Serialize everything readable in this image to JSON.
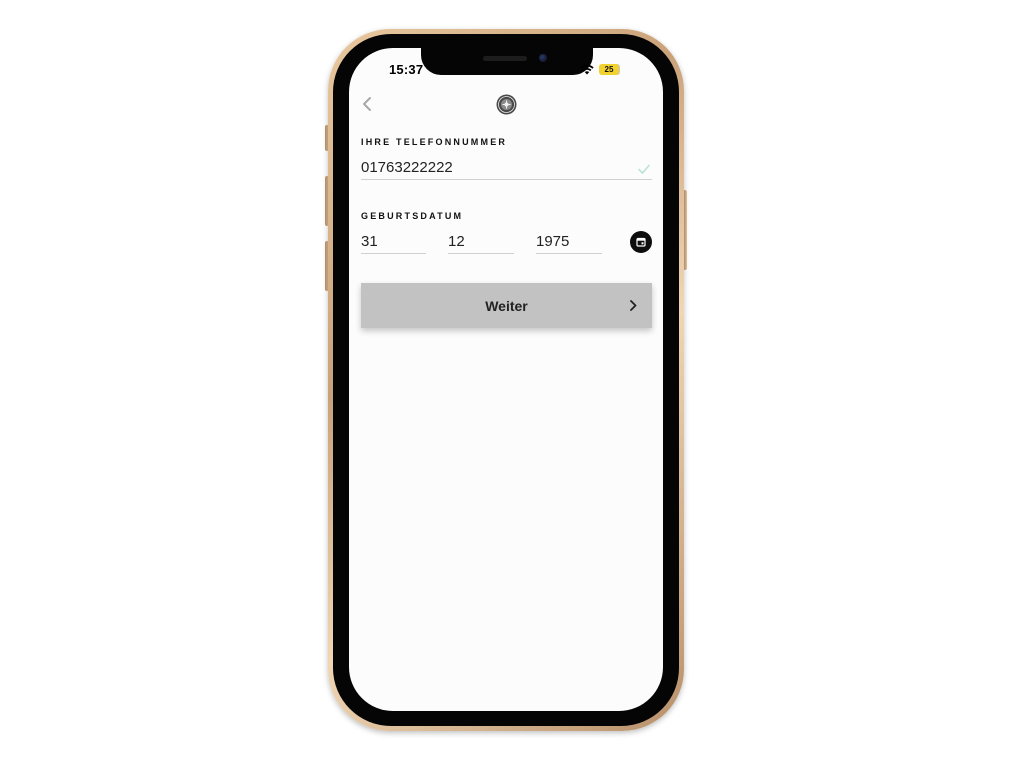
{
  "status_bar": {
    "time": "15:37",
    "battery": "25"
  },
  "header": {
    "back_icon": "chevron-left-icon",
    "logo_icon": "seal-logo-icon"
  },
  "phone_section": {
    "label": "IHRE TELEFONNUMMER",
    "value": "01763222222",
    "valid_icon": "check-icon"
  },
  "birthdate_section": {
    "label": "GEBURTSDATUM",
    "day": "31",
    "month": "12",
    "year": "1975",
    "calendar_icon": "calendar-icon"
  },
  "continue_button": {
    "label": "Weiter",
    "icon": "chevron-right-icon"
  },
  "colors": {
    "button_bg": "#c2c2c2",
    "frame_gold": "#caa27a",
    "battery": "#f2d230",
    "check": "#b9e3d9"
  }
}
